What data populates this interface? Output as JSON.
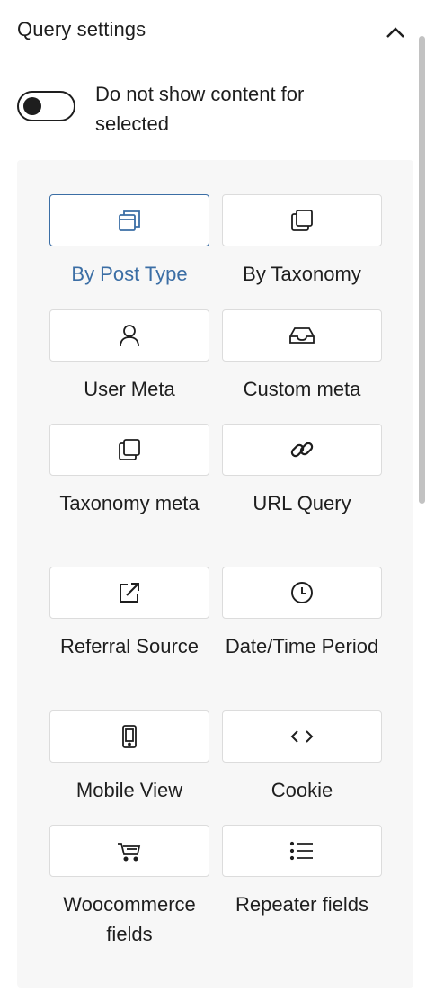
{
  "panel": {
    "title": "Query settings",
    "collapse_icon": "chevron-up-icon"
  },
  "toggle": {
    "label": "Do not show content for selected",
    "checked": false
  },
  "options": [
    {
      "label": "By Post Type",
      "icon": "windows-icon",
      "selected": true
    },
    {
      "label": "By Taxonomy",
      "icon": "copy-icon",
      "selected": false
    },
    {
      "label": "User Meta",
      "icon": "user-icon",
      "selected": false
    },
    {
      "label": "Custom meta",
      "icon": "inbox-icon",
      "selected": false
    },
    {
      "label": "Taxonomy meta",
      "icon": "copy-icon",
      "selected": false
    },
    {
      "label": "URL Query",
      "icon": "link-icon",
      "selected": false
    },
    {
      "label": "Referral Source",
      "icon": "external-link-icon",
      "selected": false
    },
    {
      "label": "Date/Time Period",
      "icon": "clock-icon",
      "selected": false
    },
    {
      "label": "Mobile View",
      "icon": "mobile-icon",
      "selected": false
    },
    {
      "label": "Cookie",
      "icon": "code-icon",
      "selected": false
    },
    {
      "label": "Woocommerce fields",
      "icon": "cart-icon",
      "selected": false
    },
    {
      "label": "Repeater fields",
      "icon": "list-icon",
      "selected": false
    }
  ],
  "colors": {
    "accent": "#3b6ea5",
    "text": "#1e1e1e",
    "tile_border": "#dcdcdc",
    "box_bg": "#f7f7f7"
  }
}
